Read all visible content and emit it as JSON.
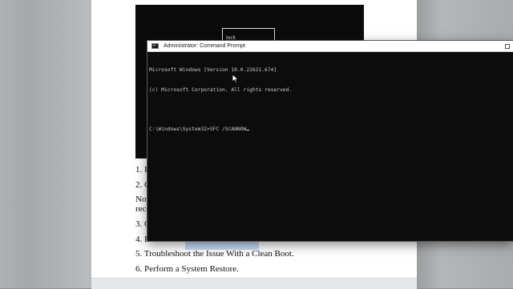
{
  "document": {
    "image_label": "lock",
    "lines": [
      "1. R",
      "2. C",
      "Not",
      "reco",
      "3. C",
      "4. R",
      "5. Troubleshoot the Issue With a Clean Boot.",
      "6. Perform a System Restore."
    ]
  },
  "cmd": {
    "title": "Administrator: Command Prompt",
    "lines": [
      "Microsoft Windows [Version 10.0.22621.674]",
      "(c) Microsoft Corporation. All rights reserved.",
      "",
      "C:\\Windows\\System32>SFC /SCANNOW"
    ]
  },
  "colors": {
    "console_bg": "#0c0c0c",
    "console_text": "#cccccc",
    "title_bar": "#ffffff"
  },
  "icons": {
    "app": "command-prompt-icon",
    "maximize": "maximize-icon",
    "pointer": "mouse-pointer-icon"
  }
}
